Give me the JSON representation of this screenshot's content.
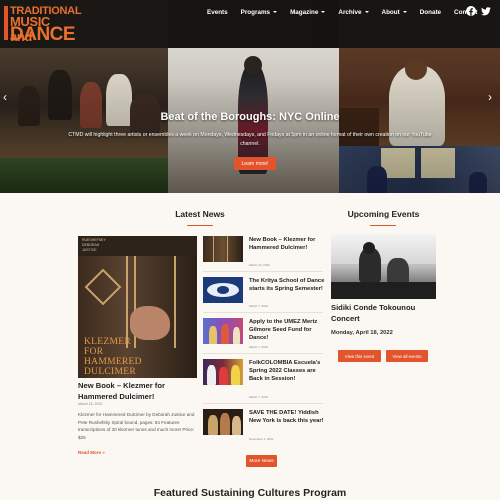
{
  "header": {
    "logo": {
      "small": "Center for",
      "line1": "TRADITIONAL",
      "line2": "MUSIC and",
      "line3": "DANCE"
    },
    "nav": [
      {
        "label": "Events",
        "dropdown": false
      },
      {
        "label": "Programs",
        "dropdown": true
      },
      {
        "label": "Magazine",
        "dropdown": true
      },
      {
        "label": "Archive",
        "dropdown": true
      },
      {
        "label": "About",
        "dropdown": true
      },
      {
        "label": "Donate",
        "dropdown": false
      },
      {
        "label": "Contact",
        "dropdown": false
      }
    ],
    "social": [
      "facebook-icon",
      "twitter-icon"
    ]
  },
  "hero": {
    "title": "Beat of the Boroughs: NYC Online",
    "description": "CTMD will highlight three artists or ensembles a week on Mondays, Wednesdays, and Fridays at 5pm in an online format of their own creation on our YouTube channel.",
    "button": "Learn more!",
    "prev": "‹",
    "next": "›"
  },
  "news": {
    "heading": "Latest News",
    "featured": {
      "image_lines": [
        "RUESHEFSKY",
        "DEBORAH",
        "JUSTICE"
      ],
      "image_big": [
        "KLEZMER",
        "FOR",
        "HAMMERED",
        "DULCIMER"
      ],
      "title": "New Book – Klezmer for Hammered Dulcimer!",
      "date": "March 16, 2022",
      "excerpt": "Klezmer for Hammered Dulcimer by Deborah Justice and Pete Rushefsky Spiral bound, pages: 84 Features transcriptions of 30 klezmer tunes and much more! Price: $25",
      "read_more": "Read More »"
    },
    "items": [
      {
        "title": "New Book – Klezmer for Hammered Dulcimer!",
        "date": "March 16, 2022"
      },
      {
        "title": "The Kritya School of Dance starts its Spring Semester!",
        "date": "March 7, 2022"
      },
      {
        "title": "Apply to the UMEZ Mertz Gilmore Seed Fund for Dance!",
        "date": "March 7, 2022"
      },
      {
        "title": "FolkCOLOMBIA Escuela’s Spring 2022 Classes are Back in Session!",
        "date": "March 7, 2022"
      },
      {
        "title": "SAVE THE DATE! Yiddish New York is back this year!",
        "date": "November 1, 2021"
      }
    ],
    "more_button": "More News"
  },
  "events": {
    "heading": "Upcoming Events",
    "title": "Sidiki Conde Tokounou Concert",
    "date": "Monday, April 18, 2022",
    "view_event": "View this event",
    "view_all": "View all events"
  },
  "featured_program": {
    "heading": "Featured Sustaining Cultures Program"
  },
  "colors": {
    "accent": "#e2542c",
    "logo": "#e9702f",
    "header_bg": "#141210",
    "page_bg": "#fbf8f3"
  }
}
